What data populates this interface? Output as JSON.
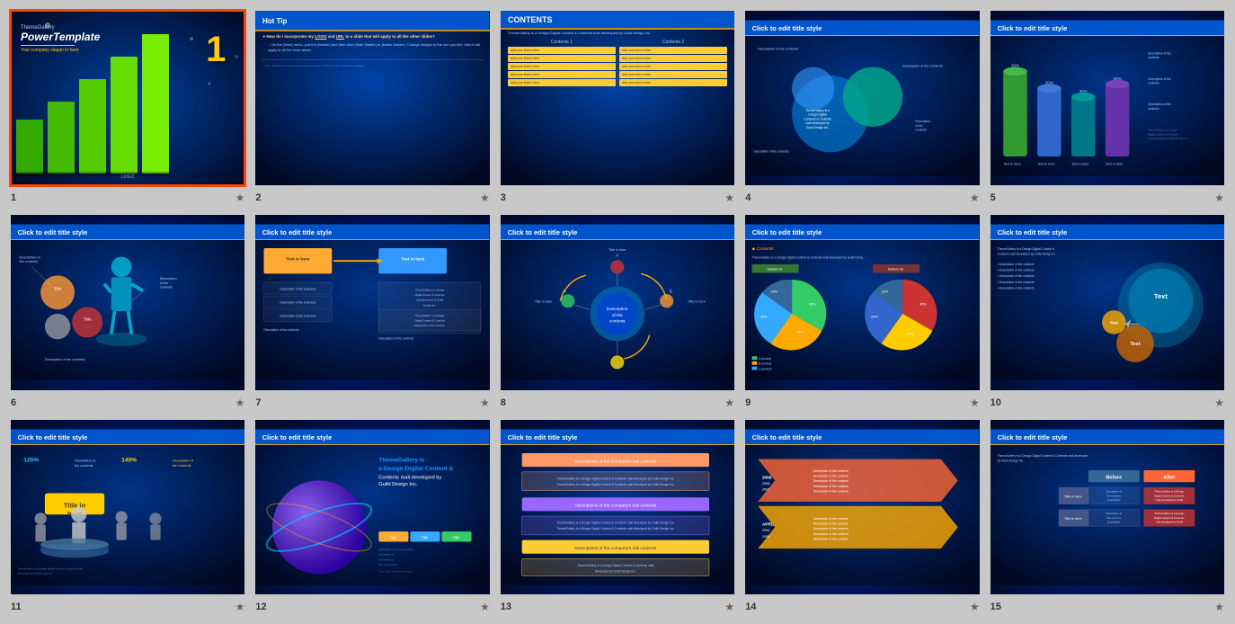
{
  "slides": [
    {
      "id": 1,
      "selected": true,
      "type": "title",
      "brand": "ThemeGallery",
      "main_title": "PowerTemplate",
      "slogan": "Your company slogan in here",
      "logo": "LOGO",
      "star": "★",
      "number_display": "1"
    },
    {
      "id": 2,
      "selected": false,
      "type": "hot_tip",
      "title": "Hot Tip",
      "star": "★",
      "content_lines": [
        "How do I incorporate my LOGO and URL to a slide that will apply to all the other slides?",
        "On the [View] menu, point to [Master] and then click [Slide Master] or [Notes Master]. Change images to the one you like, then it will apply to all the other slides."
      ]
    },
    {
      "id": 3,
      "selected": false,
      "type": "contents",
      "title": "CONTENTS",
      "star": "★",
      "description": "ThemeGallery is a Design Digital Content & Contents mall developed by Guild Design Inc.",
      "col1_label": "Contents 1",
      "col2_label": "Contents 2",
      "rows": [
        "Add your text in here",
        "Add your text in here",
        "Add your text in here",
        "Add your text in here",
        "Add your text in here"
      ]
    },
    {
      "id": 4,
      "selected": false,
      "type": "diagram",
      "title": "Click to edit title style",
      "star": "★",
      "description": "ThemeGallery is a Design Digital Content & Contents mall developed by Guild Design Inc."
    },
    {
      "id": 5,
      "selected": false,
      "type": "cylinders",
      "title": "Click to edit title style",
      "star": "★"
    },
    {
      "id": 6,
      "selected": false,
      "type": "figure",
      "title": "Click to edit title style",
      "star": "★"
    },
    {
      "id": 7,
      "selected": false,
      "type": "process",
      "title": "Click to edit title style",
      "star": "★",
      "description": "ThemeGallery is a Design Digital Content & Contents mall developed by Guild Design Inc."
    },
    {
      "id": 8,
      "selected": false,
      "type": "cycle",
      "title": "Click to edit title style",
      "star": "★"
    },
    {
      "id": 9,
      "selected": false,
      "type": "pie",
      "title": "Click to edit title style",
      "star": "★",
      "bullet": "Contents",
      "features": [
        "feature 01",
        "feature 02"
      ],
      "legend": [
        "A product",
        "B product",
        "C product"
      ]
    },
    {
      "id": 10,
      "selected": false,
      "type": "bubbles",
      "title": "Click to edit title style",
      "star": "★"
    },
    {
      "id": 11,
      "selected": false,
      "type": "people",
      "title": "Click to edit title style",
      "star": "★",
      "stats": [
        "120%",
        "140%"
      ]
    },
    {
      "id": 12,
      "selected": false,
      "type": "sphere",
      "title": "Click to edit title style",
      "star": "★",
      "main_text": "ThemeGallery is a Design Digital Content & Contents mall developed by Guild Design Inc."
    },
    {
      "id": 13,
      "selected": false,
      "type": "arrows_table",
      "title": "Click to edit title style",
      "star": "★"
    },
    {
      "id": 14,
      "selected": false,
      "type": "timeline",
      "title": "Click to edit title style",
      "star": "★"
    },
    {
      "id": 15,
      "selected": false,
      "type": "before_after",
      "title": "Click to edit title style",
      "star": "★",
      "before_label": "Before",
      "after_label": "After"
    }
  ],
  "colors": {
    "selected_border": "#ff4400",
    "slide_bg_dark": "#001133",
    "slide_bg_mid": "#002266",
    "header_bg": "#0044bb",
    "yellow": "#ffcc00",
    "teal": "#00ccdd",
    "green": "#44cc00",
    "orange": "#ff8800",
    "star": "#888888",
    "number": "#333333"
  }
}
